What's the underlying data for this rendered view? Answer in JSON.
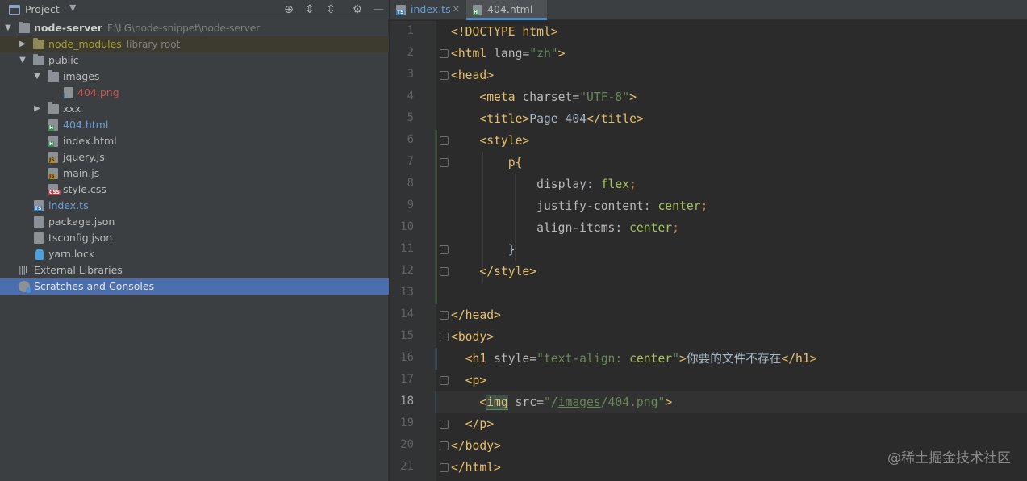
{
  "project_panel": {
    "title": "Project",
    "tree": [
      {
        "label": "node-server",
        "hint": "F:\\LG\\node-snippet\\node-server"
      },
      {
        "label": "node_modules",
        "hint": "library root"
      },
      {
        "label": "public"
      },
      {
        "label": "images"
      },
      {
        "label": "404.png"
      },
      {
        "label": "xxx"
      },
      {
        "label": "404.html"
      },
      {
        "label": "index.html"
      },
      {
        "label": "jquery.js"
      },
      {
        "label": "main.js"
      },
      {
        "label": "style.css"
      },
      {
        "label": "index.ts"
      },
      {
        "label": "package.json"
      },
      {
        "label": "tsconfig.json"
      },
      {
        "label": "yarn.lock"
      },
      {
        "label": "External Libraries"
      },
      {
        "label": "Scratches and Consoles"
      }
    ]
  },
  "tabs": [
    {
      "label": "index.ts",
      "icon_tag": "TS"
    },
    {
      "label": "404.html",
      "icon_tag": "H"
    }
  ],
  "line_numbers": [
    "1",
    "2",
    "3",
    "4",
    "5",
    "6",
    "7",
    "8",
    "9",
    "10",
    "11",
    "12",
    "13",
    "14",
    "15",
    "16",
    "17",
    "18",
    "19",
    "20",
    "21"
  ],
  "code": {
    "l1": "<!DOCTYPE html>",
    "l2_tag": "<html ",
    "l2_attr": "lang=",
    "l2_val": "\"zh\"",
    "l2_end": ">",
    "l3": "<head>",
    "l4_tag": "<meta ",
    "l4_attr": "charset=",
    "l4_val": "\"UTF-8\"",
    "l4_end": ">",
    "l5_open": "<title>",
    "l5_text": "Page 404",
    "l5_close": "</title>",
    "l6": "<style>",
    "l7": "p{",
    "l8_prop": "display",
    "l8_colon": ": ",
    "l8_val": "flex",
    "l8_semi": ";",
    "l9_prop": "justify-content",
    "l9_colon": ": ",
    "l9_val": "center",
    "l9_semi": ";",
    "l10_prop": "align-items",
    "l10_colon": ": ",
    "l10_val": "center",
    "l10_semi": ";",
    "l11": "}",
    "l12": "</style>",
    "l14": "</head>",
    "l15": "<body>",
    "l16_tag": "<h1 ",
    "l16_attr": "style=",
    "l16_val_a": "\"text-align: ",
    "l16_val_b": "center",
    "l16_val_c": "\"",
    "l16_end": ">",
    "l16_text": "你要的文件不存在",
    "l16_close": "</h1>",
    "l17": "<p>",
    "l18_lt": "<",
    "l18_img": "img",
    "l18_sp": " ",
    "l18_attr": "src=",
    "l18_val_a": "\"/",
    "l18_val_b": "images",
    "l18_val_c": "/404.png\"",
    "l18_end": ">",
    "l19": "</p>",
    "l20": "</body>",
    "l21": "</html>"
  },
  "watermark": "@稀土掘金技术社区"
}
